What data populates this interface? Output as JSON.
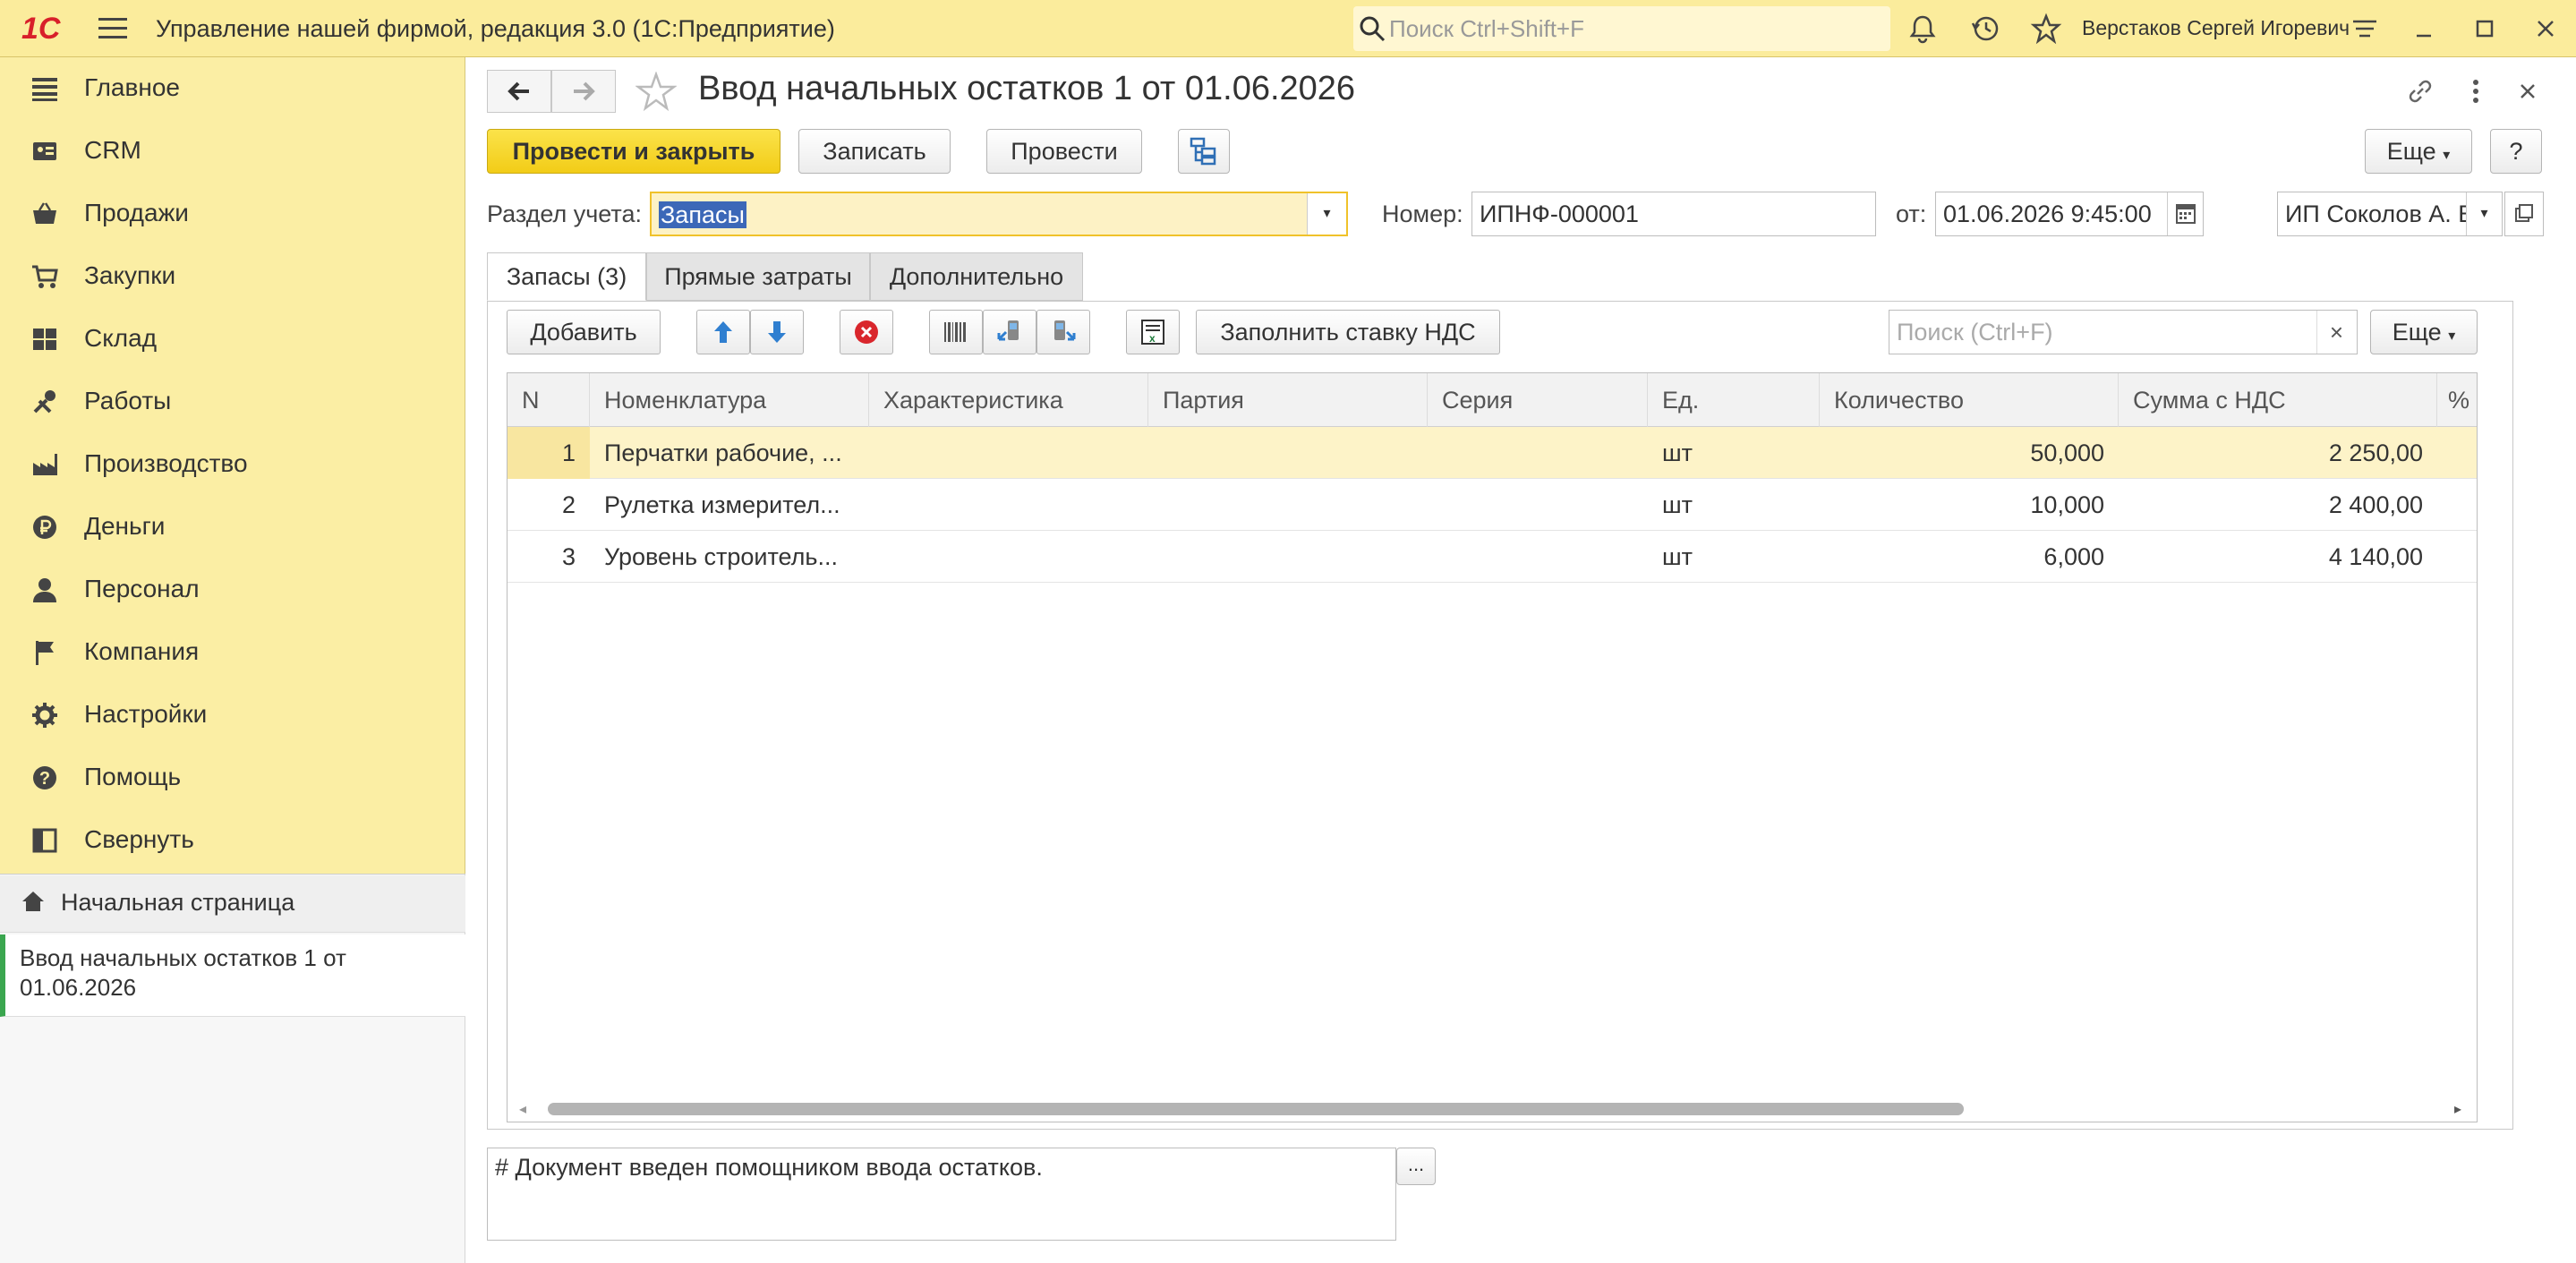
{
  "topbar": {
    "logo": "1С",
    "app_title": "Управление нашей фирмой, редакция 3.0  (1С:Предприятие)",
    "search_placeholder": "Поиск Ctrl+Shift+F",
    "user": "Верстаков Сергей Игоревич"
  },
  "sidebar": {
    "items": [
      {
        "label": "Главное",
        "icon": "menu-lines-icon"
      },
      {
        "label": "CRM",
        "icon": "crm-icon"
      },
      {
        "label": "Продажи",
        "icon": "basket-icon"
      },
      {
        "label": "Закупки",
        "icon": "cart-icon"
      },
      {
        "label": "Склад",
        "icon": "warehouse-icon"
      },
      {
        "label": "Работы",
        "icon": "tools-icon"
      },
      {
        "label": "Производство",
        "icon": "factory-icon"
      },
      {
        "label": "Деньги",
        "icon": "ruble-icon"
      },
      {
        "label": "Персонал",
        "icon": "person-icon"
      },
      {
        "label": "Компания",
        "icon": "flag-icon"
      },
      {
        "label": "Настройки",
        "icon": "gear-icon"
      },
      {
        "label": "Помощь",
        "icon": "help-icon"
      },
      {
        "label": "Свернуть",
        "icon": "collapse-icon"
      }
    ],
    "home": "Начальная страница",
    "open_doc": "Ввод начальных остатков 1 от 01.06.2026"
  },
  "doc": {
    "title": "Ввод начальных остатков 1 от 01.06.2026",
    "btn_post_close": "Провести и закрыть",
    "btn_save": "Записать",
    "btn_post": "Провести",
    "btn_more": "Еще",
    "btn_help": "?",
    "section_label": "Раздел учета:",
    "section_value": "Запасы",
    "number_label": "Номер:",
    "number_value": "ИПНФ-000001",
    "date_label": "от:",
    "date_value": "01.06.2026  9:45:00",
    "org_value": "ИП Соколов А. В."
  },
  "tabs": [
    "Запасы (3)",
    "Прямые затраты",
    "Дополнительно"
  ],
  "toolbar": {
    "add": "Добавить",
    "fill_vat": "Заполнить ставку НДС",
    "search_placeholder": "Поиск (Ctrl+F)",
    "more": "Еще",
    "clear": "×"
  },
  "table": {
    "columns": [
      "N",
      "Номенклатура",
      "Характеристика",
      "Партия",
      "Серия",
      "Ед.",
      "Количество",
      "Сумма с НДС",
      "%"
    ],
    "rows": [
      {
        "n": "1",
        "item": "Перчатки рабочие, ...",
        "char": "",
        "batch": "",
        "series": "",
        "unit": "шт",
        "qty": "50,000",
        "sum": "2 250,00"
      },
      {
        "n": "2",
        "item": "Рулетка измерител...",
        "char": "",
        "batch": "",
        "series": "",
        "unit": "шт",
        "qty": "10,000",
        "sum": "2 400,00"
      },
      {
        "n": "3",
        "item": "Уровень строитель...",
        "char": "",
        "batch": "",
        "series": "",
        "unit": "шт",
        "qty": "6,000",
        "sum": "4 140,00"
      }
    ]
  },
  "comment": {
    "text": "# Документ введен помощником ввода остатков.",
    "btn": "..."
  },
  "colors": {
    "accent_yellow": "#fbec9c",
    "button_yellow": "#f2cc17",
    "selection_green": "#3aa64f"
  }
}
